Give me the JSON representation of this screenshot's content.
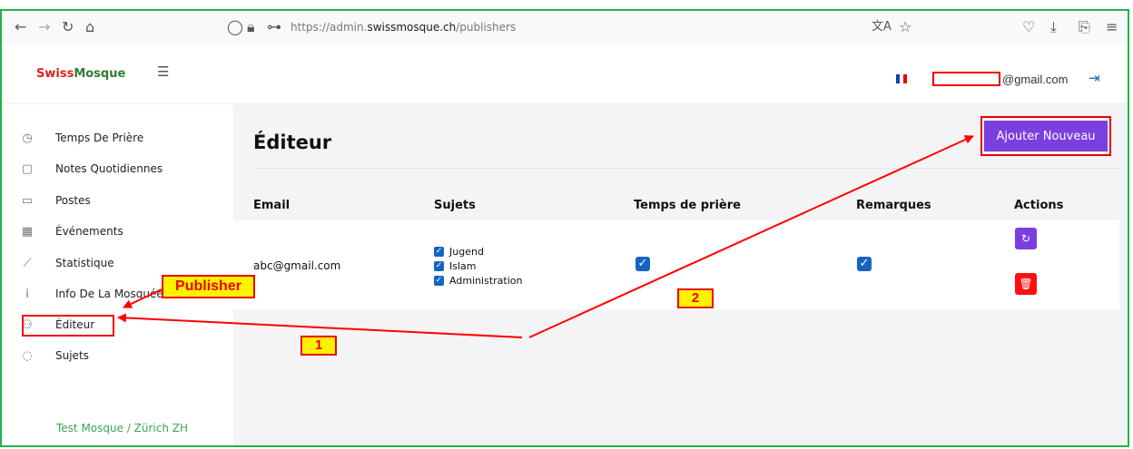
{
  "browser": {
    "url_prefix": "https://admin.",
    "url_domain": "swissmosque.ch",
    "url_path": "/publishers"
  },
  "header": {
    "brand_swiss": "Swiss",
    "brand_mosque": "Mosque",
    "email_suffix": "@gmail.com"
  },
  "sidebar": {
    "items": [
      {
        "label": "Temps De Prière",
        "icon": "clock-icon"
      },
      {
        "label": "Notes Quotidiennes",
        "icon": "note-icon"
      },
      {
        "label": "Postes",
        "icon": "chat-icon"
      },
      {
        "label": "Événements",
        "icon": "calendar-icon"
      },
      {
        "label": "Statistique",
        "icon": "chart-icon"
      },
      {
        "label": "Info De La Mosquée",
        "icon": "info-icon"
      },
      {
        "label": "Éditeur",
        "icon": "users-icon"
      },
      {
        "label": "Sujets",
        "icon": "comment-icon"
      }
    ],
    "footer": "Test Mosque / Zürich ZH"
  },
  "main": {
    "title": "Éditeur",
    "add_button": "Ajouter Nouveau",
    "columns": [
      "Email",
      "Sujets",
      "Temps de prière",
      "Remarques",
      "Actions"
    ],
    "rows": [
      {
        "email": "abc@gmail.com",
        "subjects": [
          "Jugend",
          "Islam",
          "Administration"
        ],
        "prayer_times": true,
        "remarks": true
      }
    ]
  },
  "annotations": {
    "publisher": "Publisher",
    "step1": "1",
    "step2": "2",
    "colors": {
      "arrow": "#ff0000",
      "callout_bg": "#fff200"
    }
  },
  "colors": {
    "frame": "#22b14c",
    "accent": "#7b3fe0",
    "delete": "#ff1010",
    "checkbox": "#1565c0"
  }
}
